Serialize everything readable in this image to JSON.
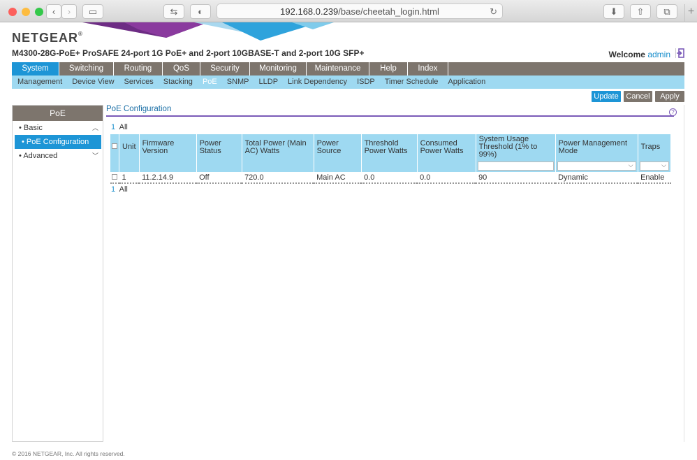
{
  "browser": {
    "url_host": "192.168.0.239",
    "url_path": "/base/cheetah_login.html"
  },
  "header": {
    "logo": "NETGEAR",
    "product": "M4300-28G-PoE+ ProSAFE 24-port 1G PoE+ and 2-port 10GBASE-T and 2-port 10G SFP+",
    "welcome": "Welcome",
    "user": "admin"
  },
  "main_nav": [
    "System",
    "Switching",
    "Routing",
    "QoS",
    "Security",
    "Monitoring",
    "Maintenance",
    "Help",
    "Index"
  ],
  "sub_nav": [
    "Management",
    "Device View",
    "Services",
    "Stacking",
    "PoE",
    "SNMP",
    "LLDP",
    "Link Dependency",
    "ISDP",
    "Timer Schedule",
    "Application"
  ],
  "actions": {
    "update": "Update",
    "cancel": "Cancel",
    "apply": "Apply"
  },
  "sidebar": {
    "title": "PoE",
    "basic": "Basic",
    "poe_config": "PoE Configuration",
    "advanced": "Advanced"
  },
  "content": {
    "title": "PoE Configuration",
    "help": "?",
    "page_num": "1",
    "page_all": "All"
  },
  "table": {
    "headers": [
      "Unit",
      "Firmware Version",
      "Power Status",
      "Total Power (Main AC) Watts",
      "Power Source",
      "Threshold Power Watts",
      "Consumed Power Watts",
      "System Usage Threshold (1% to 99%)",
      "Power Management Mode",
      "Traps"
    ],
    "row": [
      "1",
      "11.2.14.9",
      "Off",
      "720.0",
      "Main AC",
      "0.0",
      "0.0",
      "90",
      "Dynamic",
      "Enable"
    ]
  },
  "footer": "© 2016 NETGEAR, Inc. All rights reserved.",
  "colors": {
    "accent": "#1d95d6",
    "nav": "#7d756d",
    "light": "#9ed9f1",
    "purple": "#7a5ab8"
  }
}
